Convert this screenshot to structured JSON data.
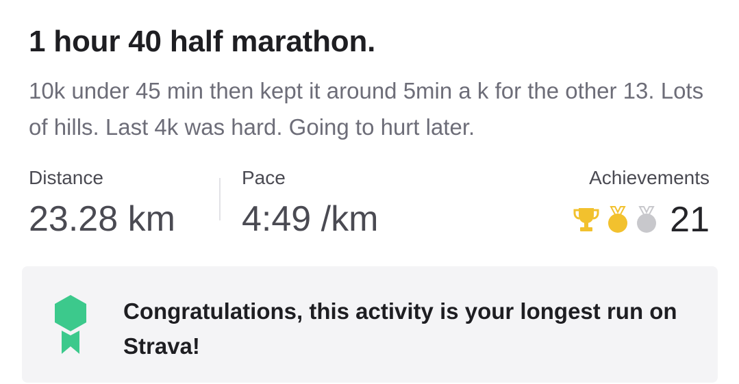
{
  "activity": {
    "title": "1 hour 40 half marathon.",
    "description": "10k under 45 min then kept it around 5min a k for the other 13. Lots of hills. Last 4k was hard. Going to hurt later."
  },
  "stats": {
    "distance": {
      "label": "Distance",
      "value": "23.28 km"
    },
    "pace": {
      "label": "Pace",
      "value": "4:49 /km"
    },
    "achievements": {
      "label": "Achievements",
      "count": "21",
      "icons": [
        "trophy-icon",
        "gold-medal-icon",
        "silver-medal-icon"
      ]
    }
  },
  "banner": {
    "icon": "award-ribbon-icon",
    "text": "Congratulations, this activity is your longest run on Strava!"
  },
  "colors": {
    "gold": "#f2c12e",
    "silver": "#c8c8cc",
    "award_green": "#3cc98c",
    "banner_bg": "#f4f4f6"
  }
}
